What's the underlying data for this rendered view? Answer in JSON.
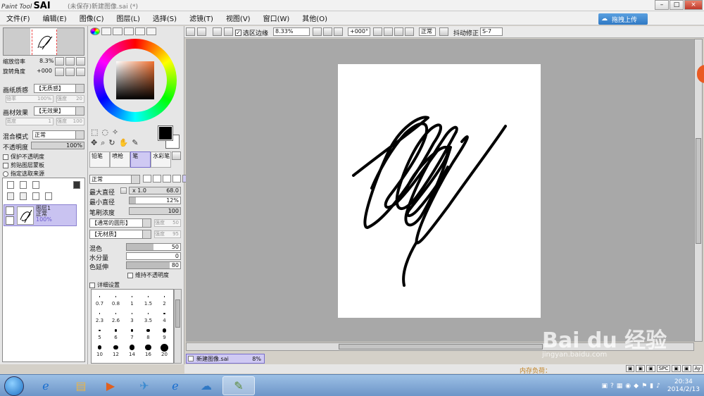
{
  "window": {
    "logo_text": "Paint Tool",
    "logo_bold": "SAI",
    "title": "(未保存)新建图像.sai (*)",
    "buttons": {
      "minimize": "–",
      "maximize": "□",
      "close": "×"
    }
  },
  "menu": [
    "文件(F)",
    "编辑(E)",
    "图像(C)",
    "图层(L)",
    "选择(S)",
    "滤镜(T)",
    "视图(V)",
    "窗口(W)",
    "其他(O)"
  ],
  "upload_button": "拖拽上传",
  "navigator": {
    "zoom_label": "缩放倍率",
    "zoom_value": "8.3%",
    "rotate_label": "旋转角度",
    "rotate_value": "+000"
  },
  "paper": {
    "texture_label": "画纸质感",
    "texture_value": "【无质感】",
    "texture_scale_label": "倍率",
    "texture_scale": "100%",
    "texture_strength_label": "强度",
    "texture_strength": "20",
    "effect_label": "画材效果",
    "effect_value": "【无效果】",
    "effect_width_label": "宽度",
    "effect_width": "1",
    "effect_strength_label": "强度",
    "effect_strength": "100"
  },
  "layer_props": {
    "blend_label": "混合模式",
    "blend_value": "正常",
    "opacity_label": "不透明度",
    "opacity_value": "100%",
    "opacity_fraction": 1.0,
    "protect_opacity": "保护不透明度",
    "clip_group": "剪贴图层蒙板",
    "selection_source": "指定选取来源"
  },
  "layer": {
    "name": "图层1",
    "mode": "正常",
    "opacity": "100%"
  },
  "tools": {
    "brushes": [
      {
        "label": "铅笔",
        "selected": false
      },
      {
        "label": "喷枪",
        "selected": false
      },
      {
        "label": "笔",
        "selected": true
      },
      {
        "label": "水彩笔",
        "selected": false
      }
    ],
    "blend": "正常",
    "max_size_label": "最大直径",
    "max_size_mult": "x 1.0",
    "max_size_value": "68.0",
    "min_size_label": "最小直径",
    "min_size_value": "12%",
    "min_size_fraction": 0.12,
    "density_label": "笔刷浓度",
    "density_value": "100",
    "density_fraction": 1.0,
    "shape_value": "【通常的圆形】",
    "shape_strength_label": "强度",
    "shape_strength": "50",
    "texture_value": "【无材质】",
    "texture_strength_label": "强度",
    "texture_strength": "95",
    "blending_label": "混色",
    "blending_value": "50",
    "blending_fraction": 0.5,
    "dilution_label": "水分量",
    "dilution_value": "0",
    "dilution_fraction": 0.0,
    "persistence_label": "色延伸",
    "persistence_value": "80",
    "persistence_fraction": 0.8,
    "keep_opacity": "维持不透明度",
    "detail_settings": "详细设置"
  },
  "brush_sizes": [
    "0.7",
    "0.8",
    "1",
    "1.5",
    "2",
    "2.3",
    "2.6",
    "3",
    "3.5",
    "4",
    "5",
    "6",
    "7",
    "8",
    "9",
    "10",
    "12",
    "14",
    "16",
    "20"
  ],
  "canvas_toolbar": {
    "selection_edge": "选区边缘",
    "zoom": "8.33%",
    "rotation": "+000°",
    "mode": "正常",
    "stabilizer_label": "抖动修正",
    "stabilizer_value": "S-7"
  },
  "doc_tab": {
    "name": "新建图像.sai",
    "zoom": "8%"
  },
  "status": {
    "memory": "内存负荷："
  },
  "status_buttons": [
    "SPC",
    "Ay"
  ],
  "watermark": {
    "main": "Bai du 经验",
    "sub": "jingyan.baidu.com"
  },
  "taskbar": {
    "time": "20:34",
    "date": "2014/2/13"
  },
  "colors": {
    "accent": "#cfc9f3",
    "canvas_bg": "#a8a8a8",
    "upload": "#2f78c4"
  },
  "icons": [
    "paint-icon",
    "selection-icon",
    "lasso-icon",
    "magic-wand-icon",
    "move-icon",
    "zoom-icon",
    "rotate-icon",
    "hand-icon",
    "eyedropper-icon"
  ]
}
